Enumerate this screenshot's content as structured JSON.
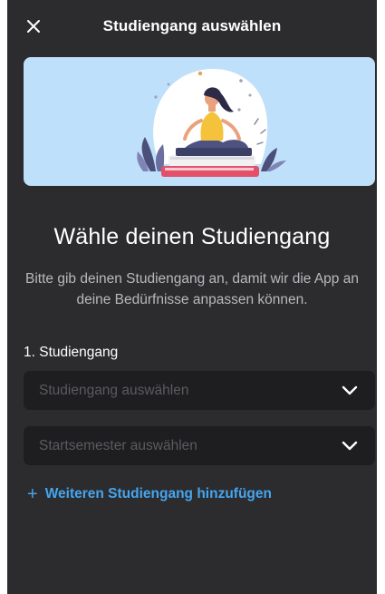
{
  "header": {
    "title": "Studiengang auswählen",
    "close_icon": "close-icon"
  },
  "hero": {
    "image": "illustration-meditating-woman-on-books"
  },
  "content": {
    "title": "Wähle deinen Studiengang",
    "subtitle": "Bitte gib deinen Studiengang an, damit wir die App an deine Bedürfnisse anpassen können."
  },
  "form": {
    "section_label": "1. Studiengang",
    "program_select": {
      "placeholder": "Studiengang auswählen",
      "icon": "chevron-down-icon"
    },
    "semester_select": {
      "placeholder": "Startsemester auswählen",
      "icon": "chevron-down-icon"
    },
    "add_program": {
      "icon": "plus-icon",
      "label": "Weiteren Studiengang hinzufügen"
    }
  },
  "colors": {
    "background": "#2c2c2e",
    "hero_background": "#bfe0fb",
    "select_background": "#1e1e20",
    "accent": "#45a5f0",
    "text_primary": "#ffffff",
    "text_secondary": "#b9b9bd",
    "placeholder": "#5b5b60"
  }
}
